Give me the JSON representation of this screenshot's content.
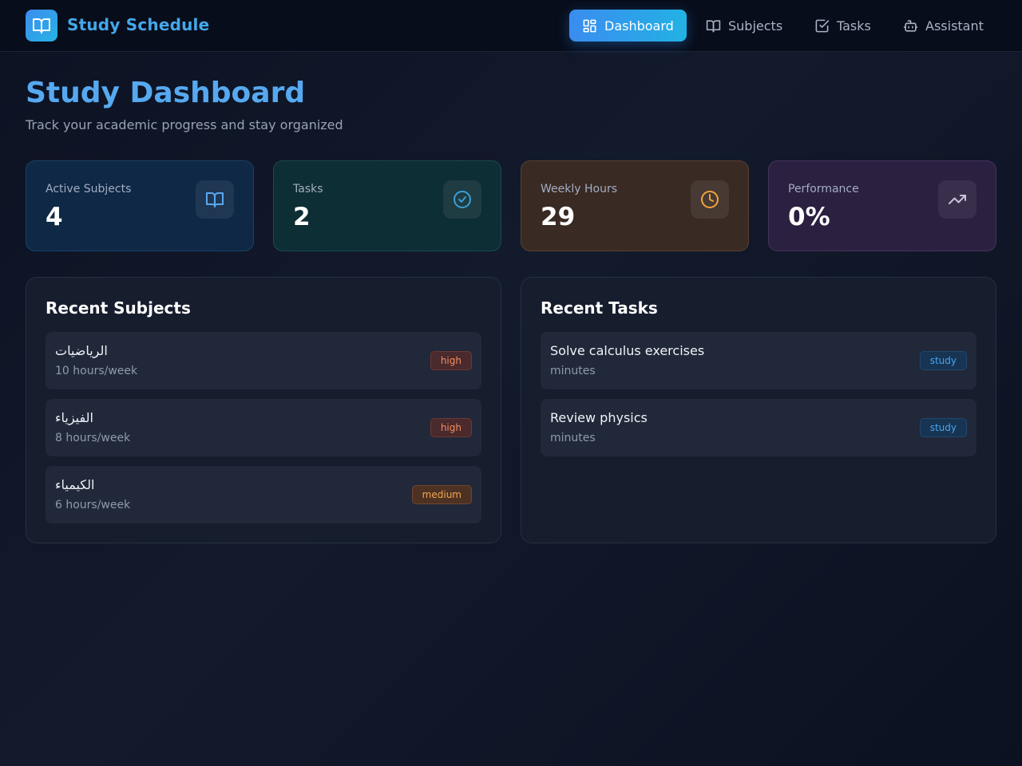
{
  "app": {
    "title": "Study Schedule",
    "logo_icon": "book-open-icon",
    "accent_color": "#3b8dee"
  },
  "nav": {
    "items": [
      {
        "label": "Dashboard",
        "icon": "grid-icon",
        "active": true
      },
      {
        "label": "Subjects",
        "icon": "book-open-icon",
        "active": false
      },
      {
        "label": "Tasks",
        "icon": "check-square-icon",
        "active": false
      },
      {
        "label": "Assistant",
        "icon": "bot-icon",
        "active": false
      }
    ]
  },
  "header": {
    "title": "Study Dashboard",
    "subtitle": "Track your academic progress and stay organized"
  },
  "stats": [
    {
      "label": "Active Subjects",
      "value": "4",
      "icon": "book-open-icon",
      "color": "#5aa8f0"
    },
    {
      "label": "Tasks",
      "value": "2",
      "icon": "check-circle-icon",
      "color": "#3a9fd6"
    },
    {
      "label": "Weekly Hours",
      "value": "29",
      "icon": "clock-icon",
      "color": "#f0a33a"
    },
    {
      "label": "Performance",
      "value": "0%",
      "icon": "trending-up-icon",
      "color": "#c9c3d8"
    }
  ],
  "recent_subjects": {
    "title": "Recent Subjects",
    "items": [
      {
        "name": "الرياضيات",
        "hours": "10 hours/week",
        "priority": "high"
      },
      {
        "name": "الفيزياء",
        "hours": "8 hours/week",
        "priority": "high"
      },
      {
        "name": "الكيمياء",
        "hours": "6 hours/week",
        "priority": "medium"
      }
    ]
  },
  "recent_tasks": {
    "title": "Recent Tasks",
    "items": [
      {
        "name": "Solve calculus exercises",
        "duration": "minutes",
        "type": "study"
      },
      {
        "name": "Review physics",
        "duration": "minutes",
        "type": "study"
      }
    ]
  }
}
